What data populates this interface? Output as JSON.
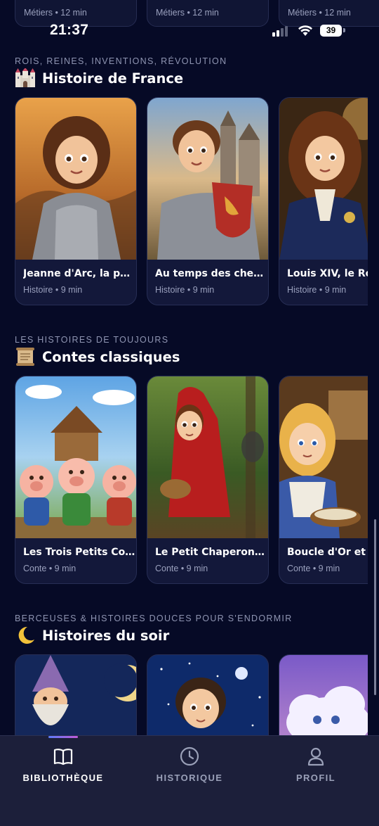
{
  "status_bar": {
    "time": "21:37",
    "battery": "39"
  },
  "top_row": {
    "items": [
      {
        "meta": "Métiers • 12 min"
      },
      {
        "meta": "Métiers • 12 min"
      },
      {
        "meta": "Métiers • 12 min"
      }
    ]
  },
  "sections": [
    {
      "kicker": "ROIS, REINES, INVENTIONS, RÉVOLUTION",
      "title": "Histoire de France",
      "icon": "castle-icon",
      "cards": [
        {
          "title": "Jeanne d'Arc, la pe...",
          "meta": "Histoire • 9 min"
        },
        {
          "title": "Au temps des chev...",
          "meta": "Histoire • 9 min"
        },
        {
          "title": "Louis XIV, le Roi S",
          "meta": "Histoire • 9 min"
        }
      ]
    },
    {
      "kicker": "LES HISTOIRES DE TOUJOURS",
      "title": "Contes classiques",
      "icon": "scroll-icon",
      "cards": [
        {
          "title": "Les Trois Petits Co...",
          "meta": "Conte • 9 min"
        },
        {
          "title": "Le Petit Chaperon ...",
          "meta": "Conte • 9 min"
        },
        {
          "title": "Boucle d'Or et le",
          "meta": "Conte • 9 min"
        }
      ]
    },
    {
      "kicker": "BERCEUSES & HISTOIRES DOUCES POUR S'ENDORMIR",
      "title": "Histoires du soir",
      "icon": "crescent-moon-icon",
      "cards": [
        {
          "title": "",
          "meta": ""
        },
        {
          "title": "",
          "meta": ""
        },
        {
          "title": "",
          "meta": ""
        }
      ]
    }
  ],
  "bottom_nav": {
    "items": [
      {
        "label": "BIBLIOTHÈQUE",
        "icon": "book-icon",
        "active": true
      },
      {
        "label": "HISTORIQUE",
        "icon": "clock-icon",
        "active": false
      },
      {
        "label": "PROFIL",
        "icon": "person-icon",
        "active": false
      }
    ]
  },
  "colors": {
    "background": "#060a26",
    "card": "#13183a",
    "nav_background": "#1c1f3a",
    "active_label": "#ffffff",
    "inactive_label": "#9aa0b8",
    "indicator_gradient": [
      "#5b7cfa",
      "#c05ad8"
    ]
  }
}
